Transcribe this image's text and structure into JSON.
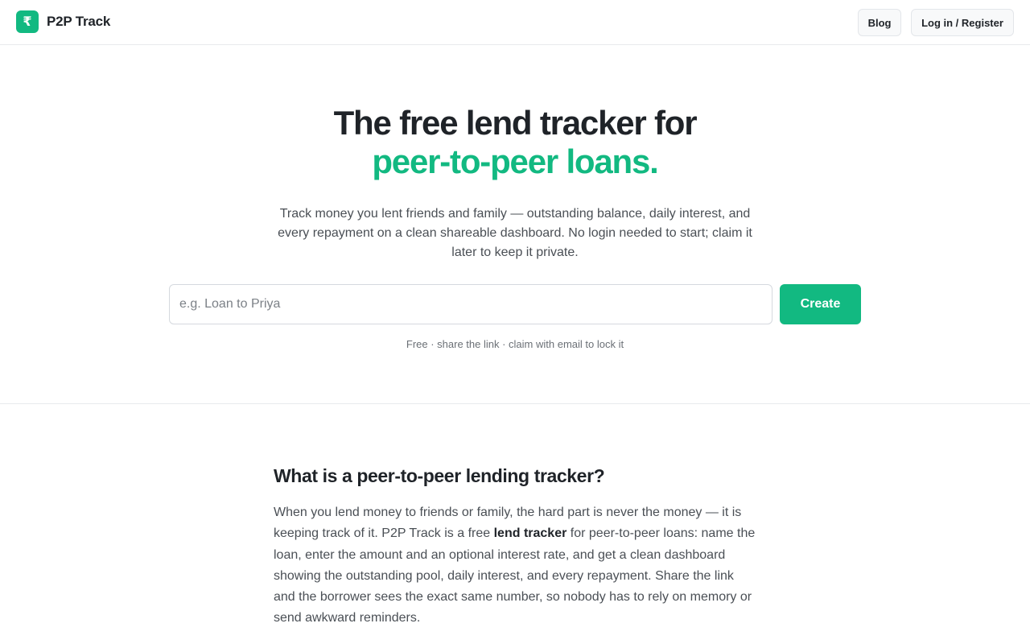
{
  "header": {
    "logo_glyph": "₹",
    "brand_name": "P2P Track",
    "blog_label": "Blog",
    "login_label": "Log in / Register"
  },
  "hero": {
    "title_line1": "The free lend tracker for",
    "title_line2": "peer-to-peer loans.",
    "subtitle": "Track money you lent friends and family — outstanding balance, daily interest, and every repayment on a clean shareable dashboard. No login needed to start; claim it later to keep it private.",
    "input_placeholder": "e.g. Loan to Priya",
    "input_value": "",
    "create_label": "Create",
    "note": "Free · share the link · claim with email to lock it"
  },
  "section": {
    "title": "What is a peer-to-peer lending tracker?",
    "body_before": "When you lend money to friends or family, the hard part is never the money — it is keeping track of it. P2P Track is a free ",
    "body_bold": "lend tracker",
    "body_after": " for peer-to-peer loans: name the loan, enter the amount and an optional interest rate, and get a clean dashboard showing the outstanding pool, daily interest, and every repayment. Share the link and the borrower sees the exact same number, so nobody has to rely on memory or send awkward reminders."
  },
  "colors": {
    "accent": "#12b981",
    "text": "#1f2328",
    "muted": "#4a4f55"
  }
}
